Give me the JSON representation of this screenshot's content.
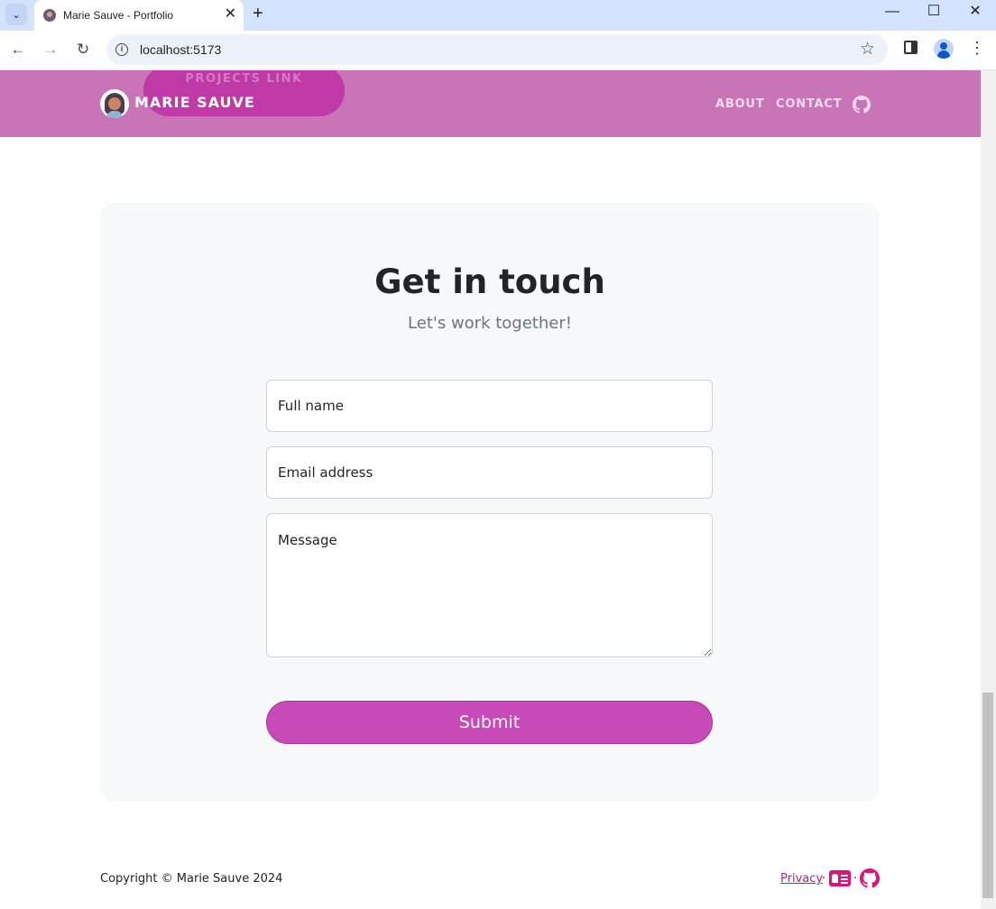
{
  "browser": {
    "tab_title": "Marie Sauve - Portfolio",
    "url": "localhost:5173",
    "tab_close": "✕",
    "new_tab": "+",
    "minimize": "—",
    "maximize": "☐",
    "close": "✕"
  },
  "header": {
    "projects_link": "PROJECTS LINK",
    "brand": "MARIE SAUVE",
    "nav": [
      "ABOUT",
      "CONTACT"
    ],
    "accent": "#c974b7"
  },
  "contact": {
    "title": "Get in touch",
    "subtitle": "Let's work together!",
    "full_name_placeholder": "Full name",
    "email_placeholder": "Email address",
    "message_placeholder": "Message",
    "submit_label": "Submit",
    "button_color": "#c849b8"
  },
  "footer": {
    "copyright": "Copyright © Marie Sauve 2024",
    "privacy": "Privacy",
    "separator": "·",
    "icons": [
      "contact-card-icon",
      "github-icon"
    ]
  }
}
